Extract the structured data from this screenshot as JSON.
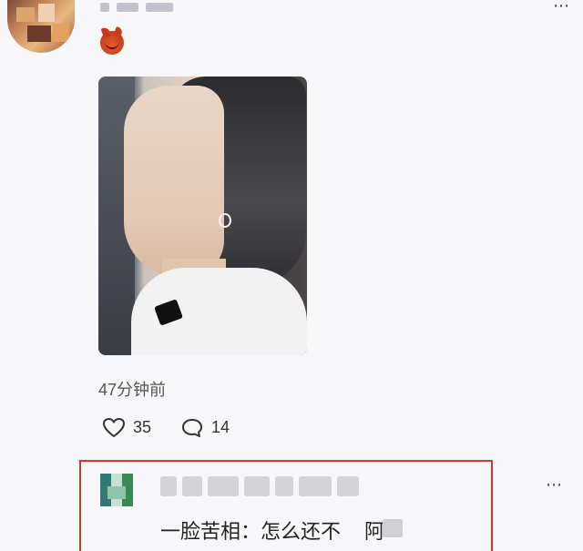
{
  "post": {
    "timestamp": "47分钟前",
    "likes": "35",
    "comments": "14",
    "more_icon": "more-dots-icon",
    "emoji_icon": "devil-emoji-icon",
    "like_icon": "heart-icon",
    "comment_icon": "comment-bubble-icon"
  },
  "reply": {
    "text": "一脸苦相：怎么还不",
    "text_tail": "阿",
    "highlight_color": "#d8342f"
  }
}
